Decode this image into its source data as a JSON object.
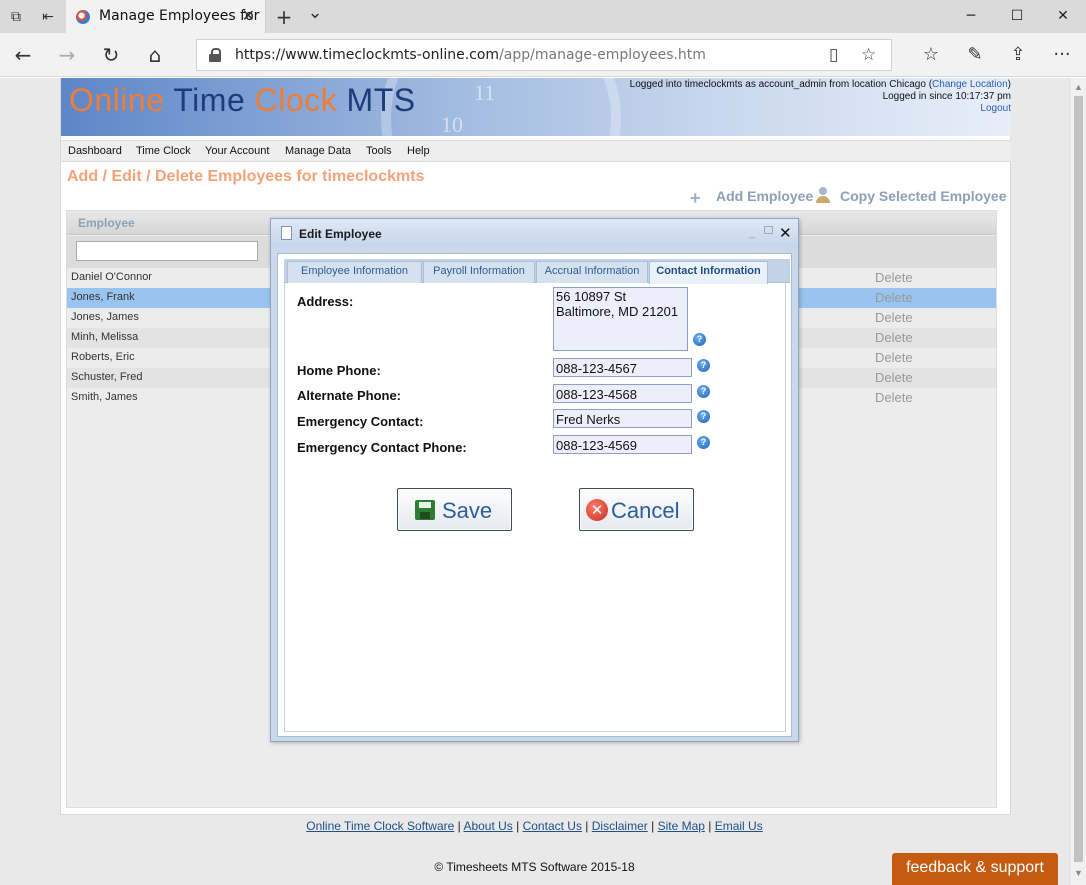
{
  "browser": {
    "tab_title": "Manage Employees for",
    "url_domain": "https://www.timeclockmts-online.com",
    "url_path": "/app/manage-employees.htm"
  },
  "header": {
    "logo": {
      "word1": "Online",
      "word2": "Time",
      "word3": "Clock",
      "word4": "MTS"
    },
    "clock_numbers": [
      "11",
      "10"
    ],
    "login_prefix": "Logged into timeclockmts as account_admin from location Chicago (",
    "change_location": "Change Location",
    "login_suffix": ")",
    "logged_in_since": "Logged in since 10:17:37 pm",
    "logout": "Logout"
  },
  "menu": [
    "Dashboard",
    "Time Clock",
    "Your Account",
    "Manage Data",
    "Tools",
    "Help"
  ],
  "page": {
    "title": "Add / Edit / Delete Employees for timeclockmts",
    "add_employee": "Add Employee",
    "copy_employee": "Copy Selected Employee"
  },
  "grid": {
    "column_employee": "Employee",
    "filter_value": "",
    "delete_label": "Delete",
    "rows": [
      "Daniel O'Connor",
      "Jones, Frank",
      "Jones, James",
      "Minh, Melissa",
      "Roberts, Eric",
      "Schuster, Fred",
      "Smith, James"
    ],
    "selected_row": "Jones, Frank"
  },
  "modal": {
    "title": "Edit Employee",
    "close_glyph": "✕",
    "tabs": [
      "Employee Information",
      "Payroll Information",
      "Accrual Information",
      "Contact Information"
    ],
    "active_tab": "Contact Information",
    "fields": {
      "address_label": "Address:",
      "address_line1": "56 10897 St",
      "address_line2": "Baltimore, MD 21201",
      "home_phone_label": "Home Phone:",
      "home_phone": "088-123-4567",
      "alt_phone_label": "Alternate Phone:",
      "alt_phone": "088-123-4568",
      "emergency_contact_label": "Emergency Contact:",
      "emergency_contact": "Fred Nerks",
      "emergency_phone_label": "Emergency Contact Phone:",
      "emergency_phone": "088-123-4569"
    },
    "help_glyph": "?",
    "save_label": "Save",
    "cancel_label": "Cancel",
    "cancel_glyph": "✕"
  },
  "footer": {
    "links": [
      "Online Time Clock Software",
      "About Us",
      "Contact Us",
      "Disclaimer",
      "Site Map",
      "Email Us"
    ],
    "separator": " | ",
    "copyright": "© Timesheets MTS Software 2015-18",
    "feedback": "feedback & support"
  },
  "icons": {
    "tabs_aside": "⧉",
    "set_aside": "⇤",
    "tab_close": "✕",
    "new_tab": "+",
    "tab_list": "⌄",
    "minimize": "─",
    "maximize": "☐",
    "close": "✕",
    "back": "←",
    "forward": "→",
    "refresh": "↻",
    "home": "⌂",
    "reading_view": "▯",
    "favorite": "☆",
    "favorites_hub": "☆",
    "pen": "✎",
    "share": "⇪",
    "more": "···",
    "add": "+"
  },
  "colors": {
    "accent_orange": "#ef7d35",
    "title_orange": "#f3a27a",
    "link_blue": "#1e4f86",
    "selected_row": "#99c4ef",
    "feedback_bg": "#c55a11"
  }
}
